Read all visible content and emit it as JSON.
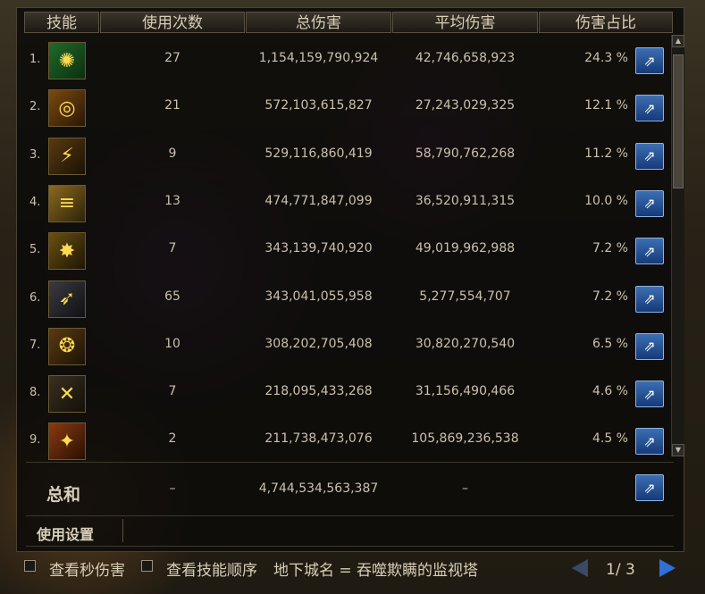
{
  "headers": {
    "skill": "技能",
    "uses": "使用次数",
    "total": "总伤害",
    "avg": "平均伤害",
    "share": "伤害占比"
  },
  "rows": [
    {
      "rank": "1.",
      "icon": "green-rune-icon",
      "uses": "27",
      "total": "1,154,159,790,924",
      "avg": "42,746,658,923",
      "share": "24.3 %"
    },
    {
      "rank": "2.",
      "icon": "spin-slash-icon",
      "uses": "21",
      "total": "572,103,615,827",
      "avg": "27,243,029,325",
      "share": "12.1 %"
    },
    {
      "rank": "3.",
      "icon": "barrage-icon",
      "uses": "9",
      "total": "529,116,860,419",
      "avg": "58,790,762,268",
      "share": "11.2 %"
    },
    {
      "rank": "4.",
      "icon": "burst-wave-icon",
      "uses": "13",
      "total": "474,771,847,099",
      "avg": "36,520,911,315",
      "share": "10.0 %"
    },
    {
      "rank": "5.",
      "icon": "explosion-icon",
      "uses": "7",
      "total": "343,139,740,920",
      "avg": "49,019,962,988",
      "share": "7.2 %"
    },
    {
      "rank": "6.",
      "icon": "dash-strike-icon",
      "uses": "65",
      "total": "343,041,055,958",
      "avg": "5,277,554,707",
      "share": "7.2 %"
    },
    {
      "rank": "7.",
      "icon": "spiral-icon",
      "uses": "10",
      "total": "308,202,705,408",
      "avg": "30,820,270,540",
      "share": "6.5 %"
    },
    {
      "rank": "8.",
      "icon": "cross-blade-icon",
      "uses": "7",
      "total": "218,095,433,268",
      "avg": "31,156,490,466",
      "share": "4.6 %"
    },
    {
      "rank": "9.",
      "icon": "fire-blade-icon",
      "uses": "2",
      "total": "211,738,473,076",
      "avg": "105,869,236,538",
      "share": "4.5 %"
    }
  ],
  "summary": {
    "label": "总和",
    "uses": "–",
    "total": "4,744,534,563,387",
    "avg": "–"
  },
  "settings_label": "使用设置",
  "footer": {
    "per_second_label": "查看秒伤害",
    "skill_order_label": "查看技能顺序",
    "dungeon_text": "地下城名 = 吞噬欺瞒的监视塔",
    "page_text": "1/ 3"
  },
  "colors": {
    "share_button": "#2a5aa0",
    "text": "#c9c1ac",
    "page_arrow": "#2f6fd8"
  }
}
